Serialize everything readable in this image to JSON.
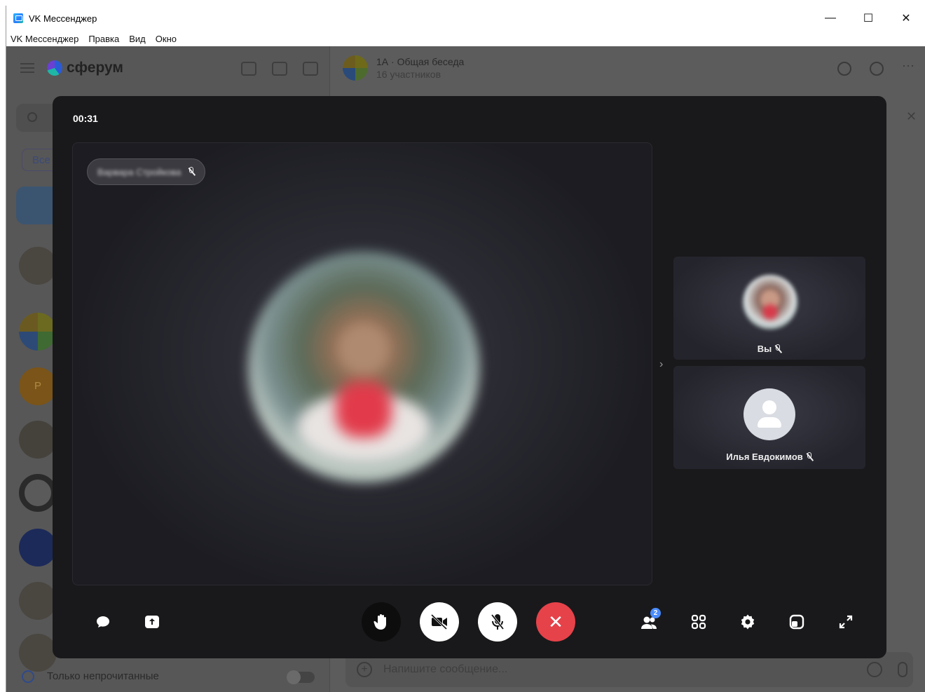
{
  "window": {
    "title": "VK Мессенджер",
    "controls": {
      "minimize": "—",
      "maximize": "☐",
      "close": "✕"
    }
  },
  "menu": [
    "VK Мессенджер",
    "Правка",
    "Вид",
    "Окно"
  ],
  "sidebar": {
    "logo": "сферум",
    "filter": "Все",
    "unread_toggle_label": "Только непрочитанные",
    "chat_avatar_letter": "P"
  },
  "conversation": {
    "title": "1А · Общая беседа",
    "subtitle": "16 участников",
    "compose_placeholder": "Напишите сообщение..."
  },
  "call": {
    "timer": "00:31",
    "main_speaker_name": "Варвара Стройкова",
    "participants": [
      {
        "label": "Вы",
        "muted": true
      },
      {
        "label": "Илья Евдокимов",
        "muted": true
      }
    ],
    "participants_badge": "2"
  },
  "colors": {
    "end_call": "#e6424a",
    "badge": "#4a8cff",
    "call_bg": "#19191b"
  }
}
